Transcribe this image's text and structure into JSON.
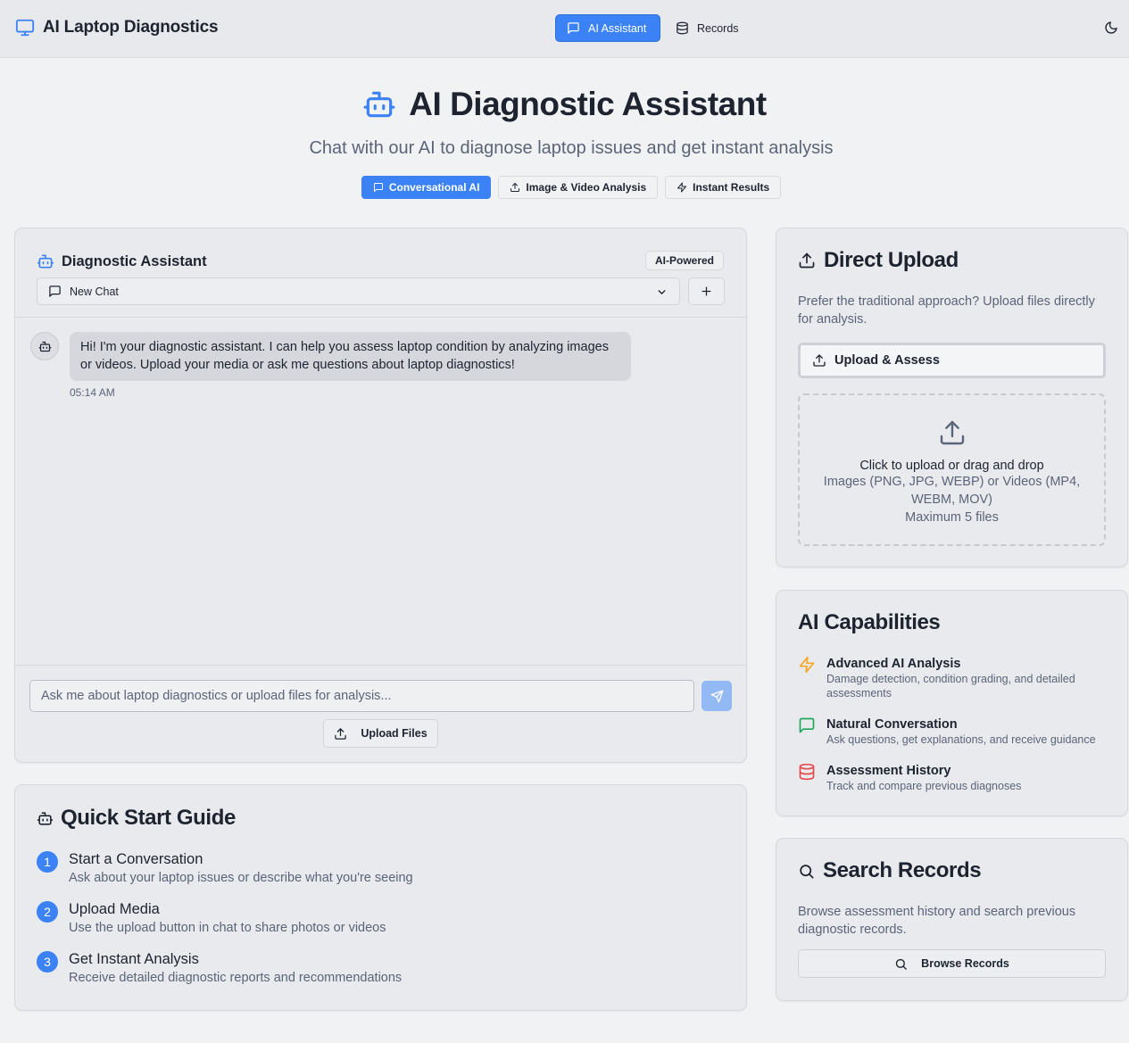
{
  "app": {
    "title": "AI Laptop Diagnostics"
  },
  "nav": {
    "ai_assistant": "AI Assistant",
    "records": "Records"
  },
  "hero": {
    "title": "AI Diagnostic Assistant",
    "subtitle": "Chat with our AI to diagnose laptop issues and get instant analysis",
    "pills": [
      "Conversational AI",
      "Image & Video Analysis",
      "Instant Results"
    ]
  },
  "chat": {
    "title": "Diagnostic Assistant",
    "badge": "AI-Powered",
    "selected_chat": "New Chat",
    "messages": [
      {
        "text": "Hi! I'm your diagnostic assistant. I can help you assess laptop condition by analyzing images or videos. Upload your media or ask me questions about laptop diagnostics!",
        "time": "05:14 AM"
      }
    ],
    "input_placeholder": "Ask me about laptop diagnostics or upload files for analysis...",
    "upload_files": "Upload Files"
  },
  "quick_start": {
    "title": "Quick Start Guide",
    "steps": [
      {
        "num": "1",
        "title": "Start a Conversation",
        "desc": "Ask about your laptop issues or describe what you're seeing"
      },
      {
        "num": "2",
        "title": "Upload Media",
        "desc": "Use the upload button in chat to share photos or videos"
      },
      {
        "num": "3",
        "title": "Get Instant Analysis",
        "desc": "Receive detailed diagnostic reports and recommendations"
      }
    ]
  },
  "direct_upload": {
    "title": "Direct Upload",
    "desc": "Prefer the traditional approach? Upload files directly for analysis.",
    "button": "Upload & Assess",
    "drop_click": "Click to upload",
    "drop_rest": " or drag and drop",
    "drop_types": "Images (PNG, JPG, WEBP) or Videos (MP4, WEBM, MOV)",
    "drop_max": "Maximum 5 files"
  },
  "capabilities": {
    "title": "AI Capabilities",
    "items": [
      {
        "title": "Advanced AI Analysis",
        "desc": "Damage detection, condition grading, and detailed assessments",
        "icon": "zap-icon",
        "color": "#f5a623"
      },
      {
        "title": "Natural Conversation",
        "desc": "Ask questions, get explanations, and receive guidance",
        "icon": "message-icon",
        "color": "#22a55a"
      },
      {
        "title": "Assessment History",
        "desc": "Track and compare previous diagnoses",
        "icon": "database-icon",
        "color": "#e5484d"
      }
    ]
  },
  "search_records": {
    "title": "Search Records",
    "desc": "Browse assessment history and search previous diagnostic records.",
    "button": "Browse Records"
  },
  "colors": {
    "accent": "#3b82f6",
    "background": "#f1f2f4",
    "card": "#e9eaed"
  }
}
